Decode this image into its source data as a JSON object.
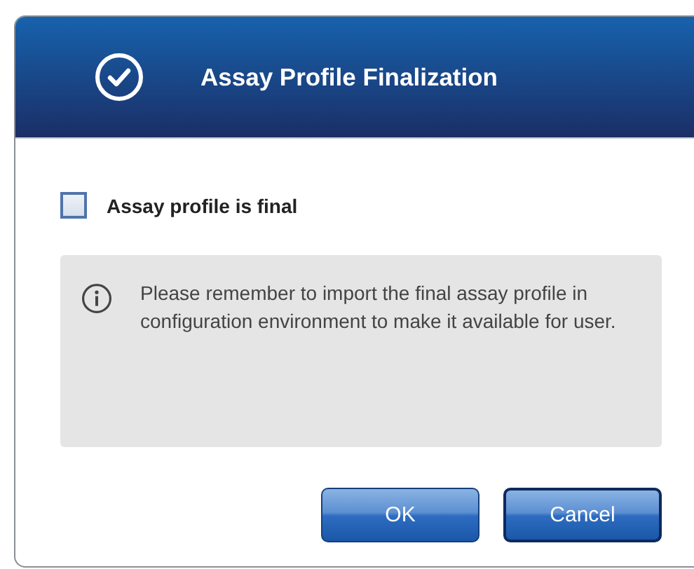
{
  "dialog": {
    "title": "Assay Profile Finalization"
  },
  "checkbox": {
    "label": "Assay profile is final",
    "checked": false
  },
  "info": {
    "message": "Please remember to import the final assay profile in configuration environment to make it available for user."
  },
  "buttons": [
    {
      "label": "OK"
    },
    {
      "label": "Cancel"
    }
  ]
}
